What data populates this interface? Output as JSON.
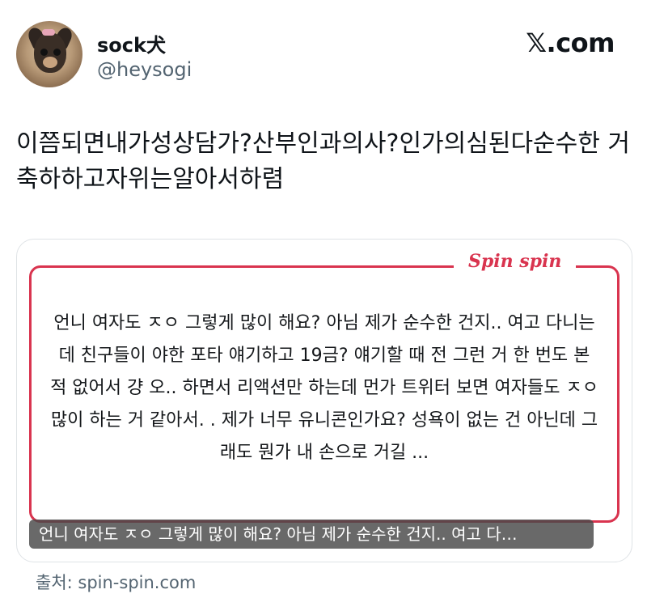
{
  "author": {
    "display_name": "sock犬",
    "handle": "@heysogi"
  },
  "site_logo": "𝕏.com",
  "tweet": {
    "text": "이쯤되면내가성상담가?산부인과의사?인가의심된다순수한 거축하하고자위는알아서하렴"
  },
  "card": {
    "brand": "Spin spin",
    "quote": "언니 여자도 ㅈㅇ 그렇게 많이 해요? 아님 제가 순수한 건지.. 여고 다니는데 친구들이 야한 포타 얘기하고 19금? 얘기할 때 전 그런 거 한 번도 본 적 없어서 걍 오.. 하면서 리액션만 하는데 먼가 트위터 보면 여자들도 ㅈㅇ 많이 하는 거 같아서. . 제가 너무 유니콘인가요? 성욕이 없는 건 아닌데 그래도 뭔가 내 손으로 거길 ...",
    "caption": "언니 여자도 ㅈㅇ 그렇게 많이 해요? 아님 제가 순수한 건지.. 여고 다…",
    "accent_color": "#d9344f"
  },
  "source": "출처: spin-spin.com"
}
